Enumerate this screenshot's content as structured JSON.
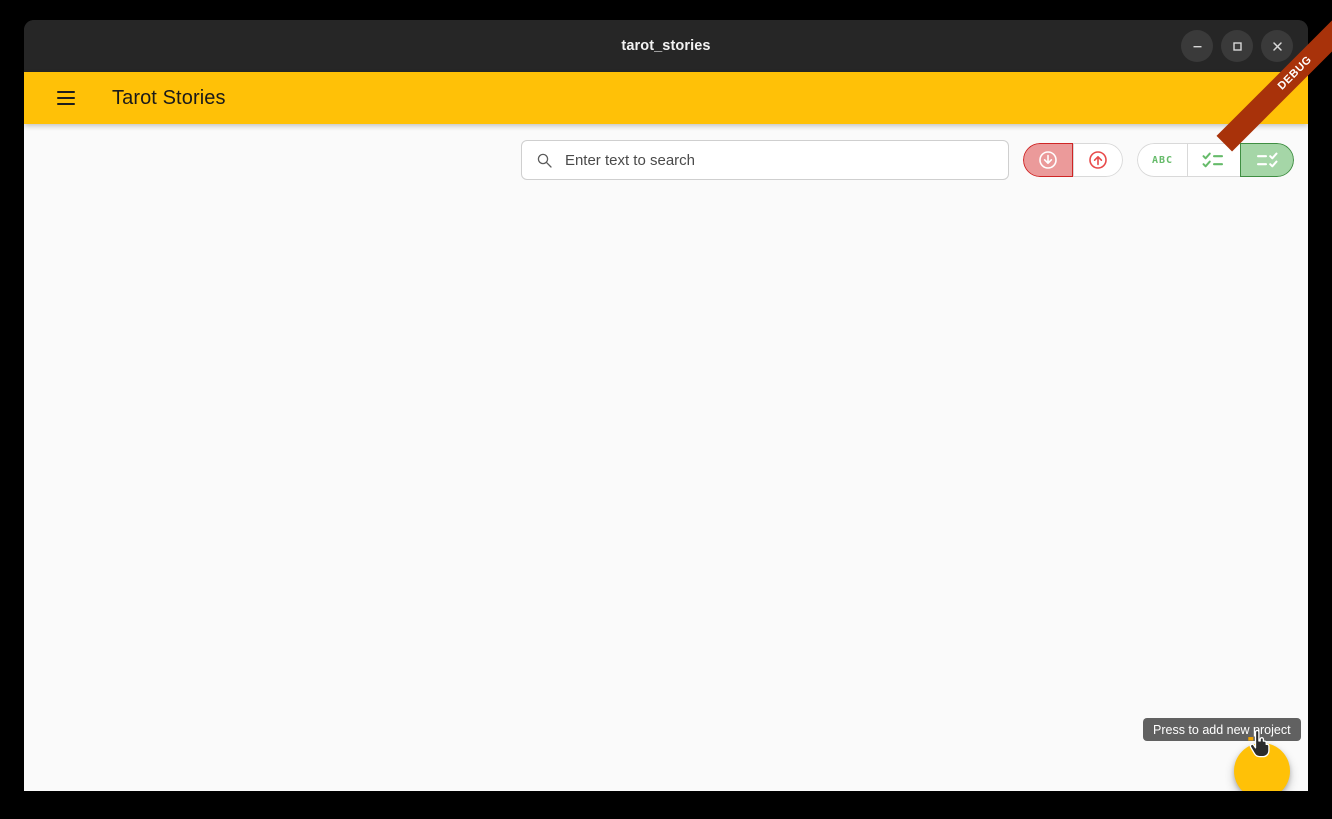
{
  "window": {
    "title": "tarot_stories",
    "controls": [
      {
        "name": "minimize",
        "label": "–",
        "icon": "minimize-icon"
      },
      {
        "name": "maximize",
        "label": "□",
        "icon": "maximize-icon"
      },
      {
        "name": "close",
        "label": "✕",
        "icon": "close-icon"
      }
    ]
  },
  "appbar": {
    "menu_icon": "hamburger-menu-icon",
    "title": "Tarot Stories",
    "background_color": "#FFC107"
  },
  "debug_ribbon": {
    "label": "DEBUG",
    "color": "#a8320a"
  },
  "search": {
    "icon": "search-icon",
    "value": "",
    "placeholder": "Enter text to search"
  },
  "toolbar": {
    "transfer_group": {
      "accent_color": "#cf2525",
      "buttons": [
        {
          "name": "download-button",
          "icon": "arrow-down-circle-icon",
          "selected": true
        },
        {
          "name": "upload-button",
          "icon": "arrow-up-circle-icon",
          "selected": false
        }
      ]
    },
    "sort_group": {
      "accent_color": "#3f8e42",
      "buttons": [
        {
          "name": "sort-alphabetical-button",
          "icon": "abc-icon",
          "label": "ABC",
          "selected": false
        },
        {
          "name": "sort-checked-first-button",
          "icon": "checklist-left-icon",
          "selected": false
        },
        {
          "name": "sort-checked-last-button",
          "icon": "checklist-right-icon",
          "selected": true
        }
      ]
    }
  },
  "fab": {
    "icon": "add-project-icon",
    "tooltip": "Press to add new project",
    "color": "#FFC107"
  },
  "content": {
    "background_color": "#FAFAFA",
    "empty_state_text": ""
  }
}
